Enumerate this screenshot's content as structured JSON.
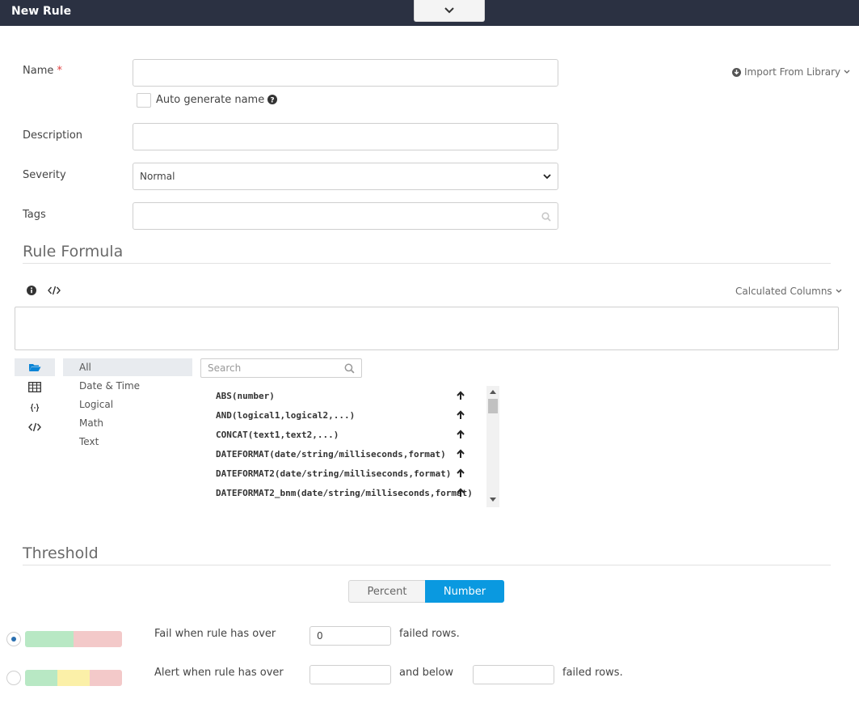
{
  "header": {
    "title": "New Rule",
    "collapse_icon": "chevron-down-icon",
    "background": "#2b3142"
  },
  "form": {
    "name_label": "Name",
    "required_mark": "*",
    "auto_generate_label": "Auto generate name",
    "help_icon": "question-circle-icon",
    "description_label": "Description",
    "severity_label": "Severity",
    "severity_value": "Normal",
    "tags_label": "Tags",
    "import_label": "Import From Library",
    "import_icon": "download-circle-icon"
  },
  "formula": {
    "section_title": "Rule Formula",
    "calc_columns_label": "Calculated Columns",
    "info_icon": "info-icon",
    "code_icon": "code-icon",
    "categories": [
      "All",
      "Date & Time",
      "Logical",
      "Math",
      "Text"
    ],
    "active_category": "All",
    "category_icons": [
      "folder-open-icon",
      "table-icon",
      "braces-icon",
      "code-icon"
    ],
    "search_placeholder": "Search",
    "functions": [
      "ABS(number)",
      "AND(logical1,logical2,...)",
      "CONCAT(text1,text2,...)",
      "DATEFORMAT(date/string/milliseconds,format)",
      "DATEFORMAT2(date/string/milliseconds,format)",
      "DATEFORMAT2_bnm(date/string/milliseconds,format)"
    ]
  },
  "threshold": {
    "section_title": "Threshold",
    "mode_options": [
      "Percent",
      "Number"
    ],
    "mode_selected": "Number",
    "accent": "#0a99e0",
    "fail_text": "Fail when rule has over",
    "fail_value": "0",
    "failed_rows_text": "failed rows.",
    "alert_text": "Alert when rule has over",
    "and_below_text": "and below",
    "alert_failed_rows_text": "failed rows.",
    "colors": {
      "green": "#b8e8c4",
      "yellow": "#fbf0a8",
      "red": "#f3c9c9"
    }
  }
}
